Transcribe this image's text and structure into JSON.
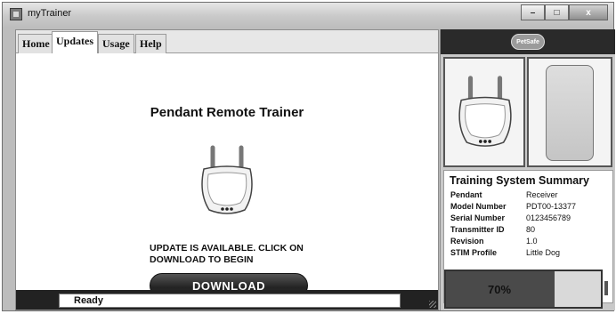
{
  "window": {
    "title": "myTrainer",
    "minimize": "–",
    "maximize": "□",
    "close": "x"
  },
  "tabs": [
    {
      "label": "Home"
    },
    {
      "label": "Updates"
    },
    {
      "label": "Usage"
    },
    {
      "label": "Help"
    }
  ],
  "active_tab": "Updates",
  "main": {
    "product_title": "Pendant Remote Trainer",
    "update_message": "UPDATE IS AVAILABLE.  CLICK ON DOWNLOAD TO BEGIN",
    "download_label": "DOWNLOAD"
  },
  "statusbar": {
    "status": "Ready"
  },
  "brand": {
    "logo_text": "PetSafe"
  },
  "summary": {
    "title": "Training System Summary",
    "rows": [
      {
        "key": "Pendant",
        "value": "Receiver"
      },
      {
        "key": "Model Number",
        "value": "PDT00-13377"
      },
      {
        "key": "Serial Number",
        "value": "0123456789"
      },
      {
        "key": "Transmitter ID",
        "value": "80"
      },
      {
        "key": "Revision",
        "value": "1.0"
      },
      {
        "key": "STIM Profile",
        "value": "Little Dog"
      }
    ]
  },
  "battery": {
    "label": "70%",
    "level": 0.7
  },
  "icons": {
    "app": "app-icon",
    "pendant": "pendant-collar-icon",
    "remote": "remote-transmitter-icon"
  }
}
